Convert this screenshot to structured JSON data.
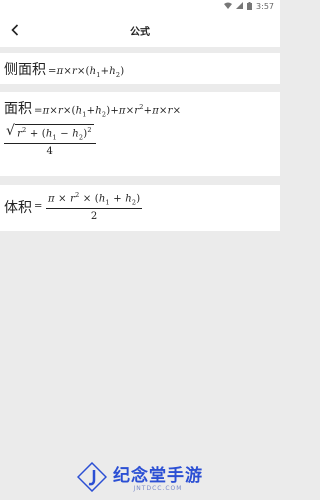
{
  "status_bar": {
    "time": "3:57",
    "icons": [
      "wifi-icon",
      "signal-icon",
      "battery-icon"
    ]
  },
  "app_bar": {
    "title": "公式",
    "back_icon": "chevron-left-icon"
  },
  "formulas": [
    {
      "label": "侧面积"
    },
    {
      "label": "面积"
    },
    {
      "label": "体积"
    }
  ],
  "watermark": {
    "title": "纪念堂手游",
    "subtitle": "JNTDCC.COM",
    "logo": "j-logo-icon",
    "color": "#2b4fd4"
  }
}
